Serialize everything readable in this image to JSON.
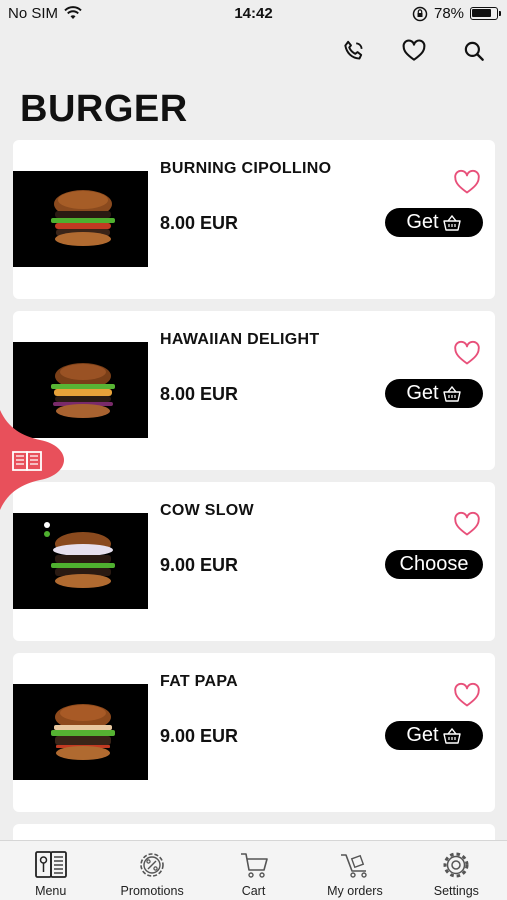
{
  "status": {
    "carrier": "No SIM",
    "time": "14:42",
    "battery": "78%"
  },
  "header": {
    "icons": [
      "phone-icon",
      "heart-icon",
      "search-icon"
    ]
  },
  "page": {
    "title": "BURGER"
  },
  "products": [
    {
      "name": "BURNING CIPOLLINO",
      "price": "8.00 EUR",
      "action": "Get",
      "has_basket": true
    },
    {
      "name": "HAWAIIAN DELIGHT",
      "price": "8.00 EUR",
      "action": "Get",
      "has_basket": true
    },
    {
      "name": "COW SLOW",
      "price": "9.00 EUR",
      "action": "Choose",
      "has_basket": false
    },
    {
      "name": "FAT PAPA",
      "price": "9.00 EUR",
      "action": "Get",
      "has_basket": true
    }
  ],
  "colors": {
    "accent": "#e8505b",
    "heart": "#e8507a",
    "button": "#000000"
  },
  "nav": {
    "items": [
      {
        "label": "Menu",
        "icon": "menu-book-icon"
      },
      {
        "label": "Promotions",
        "icon": "percent-gear-icon"
      },
      {
        "label": "Cart",
        "icon": "cart-icon"
      },
      {
        "label": "My orders",
        "icon": "delivery-cart-icon"
      },
      {
        "label": "Settings",
        "icon": "gear-icon"
      }
    ]
  }
}
